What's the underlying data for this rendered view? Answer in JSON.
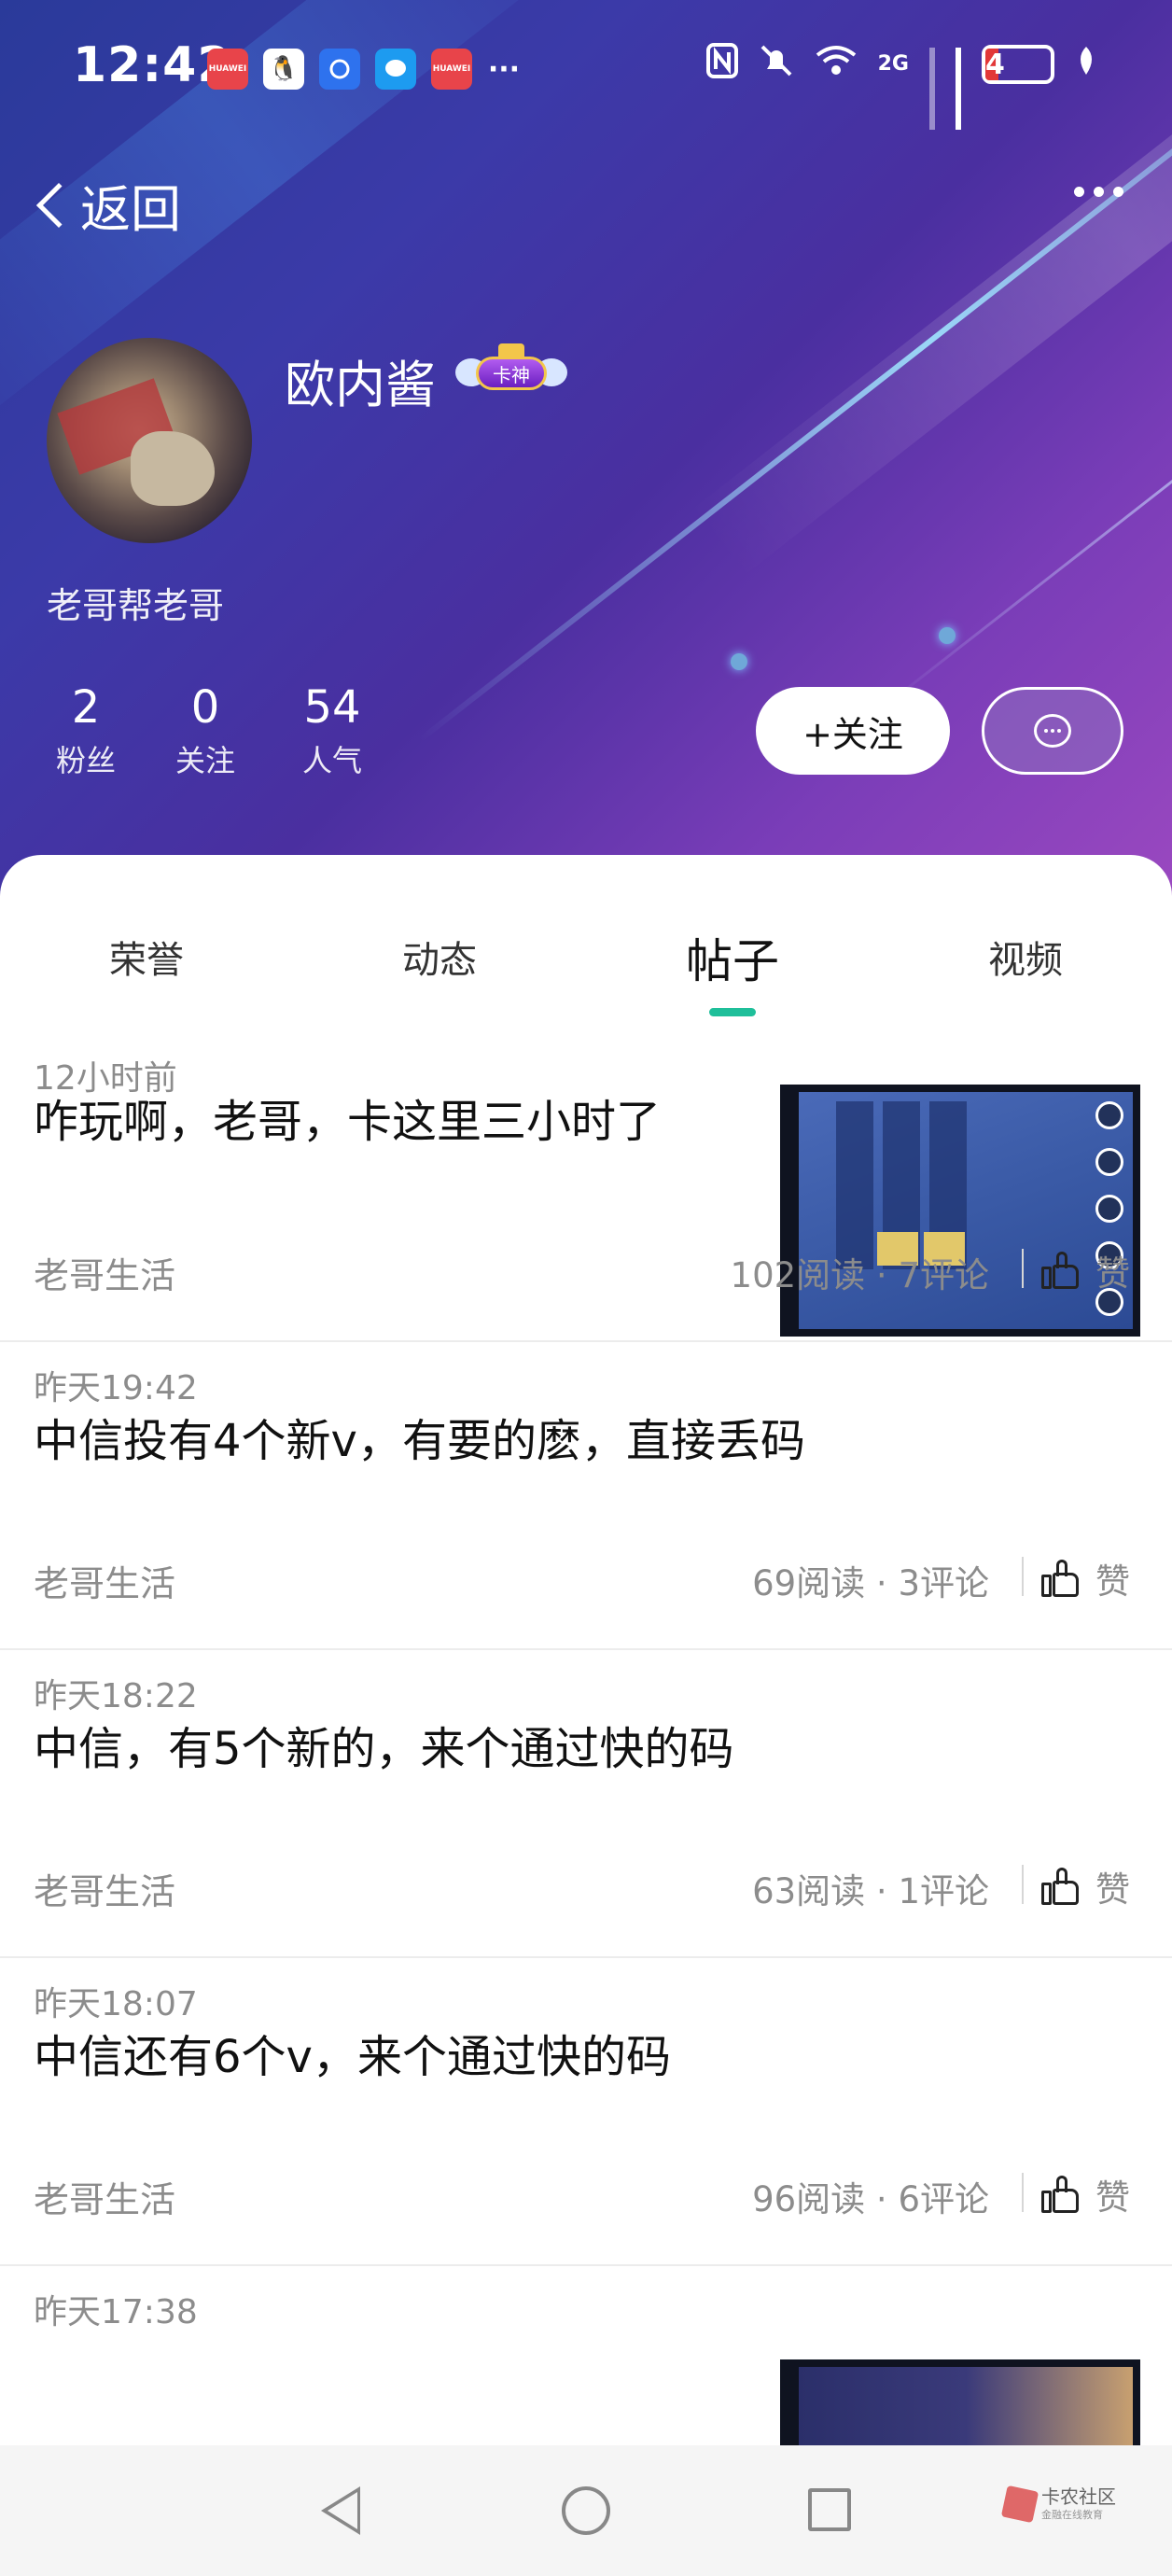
{
  "status_bar": {
    "time": "12:42",
    "notification_icons": [
      "huawei-app-icon",
      "qq-icon",
      "blue-app-icon",
      "message-icon",
      "huawei-app-icon",
      "more-dots-icon"
    ],
    "huawei_label": "HUAWEI",
    "more": "···",
    "network_label": "2G",
    "battery_level": "4"
  },
  "nav": {
    "back_label": "返回"
  },
  "profile": {
    "username": "欧内酱",
    "badge_text": "卡神",
    "bio": "老哥帮老哥",
    "stats": [
      {
        "value": "2",
        "label": "粉丝"
      },
      {
        "value": "0",
        "label": "关注"
      },
      {
        "value": "54",
        "label": "人气"
      }
    ],
    "follow_label": "+关注"
  },
  "tabs": [
    {
      "label": "荣誉",
      "active": false
    },
    {
      "label": "动态",
      "active": false
    },
    {
      "label": "帖子",
      "active": true
    },
    {
      "label": "视频",
      "active": false
    }
  ],
  "posts": [
    {
      "time": "12小时前",
      "title": "咋玩啊，老哥，卡这里三小时了",
      "category": "老哥生活",
      "meta": "102阅读 · 7评论",
      "like_label": "赞",
      "has_image": true
    },
    {
      "time": "昨天19:42",
      "title": "中信投有4个新v，有要的麽，直接丢码",
      "category": "老哥生活",
      "meta": "69阅读 · 3评论",
      "like_label": "赞",
      "has_image": false
    },
    {
      "time": "昨天18:22",
      "title": "中信，有5个新的，来个通过快的码",
      "category": "老哥生活",
      "meta": "63阅读 · 1评论",
      "like_label": "赞",
      "has_image": false
    },
    {
      "time": "昨天18:07",
      "title": "中信还有6个v，来个通过快的码",
      "category": "老哥生活",
      "meta": "96阅读 · 6评论",
      "like_label": "赞",
      "has_image": false
    },
    {
      "time": "昨天17:38",
      "has_image": true
    }
  ],
  "watermark": {
    "title": "卡农社区",
    "subtitle": "金融在线教育"
  },
  "colors": {
    "accent": "#1fbf9a",
    "header_start": "#2a3a9a",
    "header_end": "#9a48c0"
  }
}
